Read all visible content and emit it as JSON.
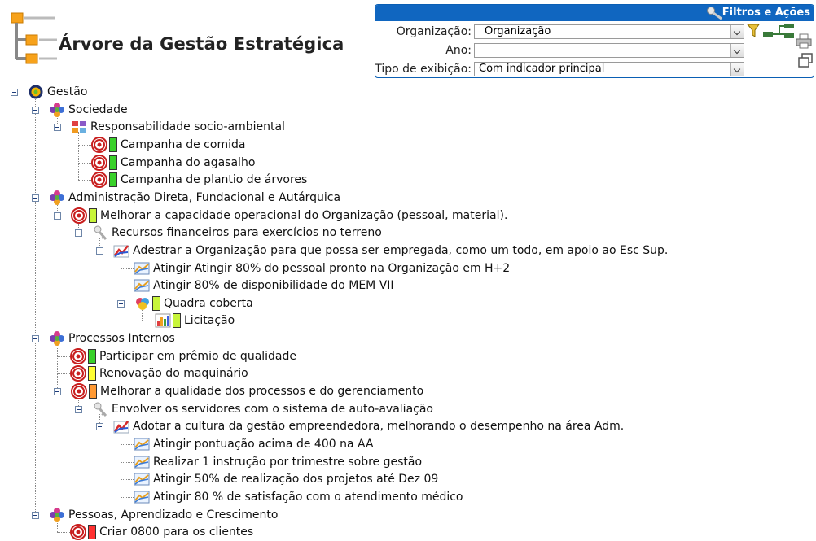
{
  "header": {
    "title": "Árvore da Gestão Estratégica"
  },
  "filters": {
    "title": "Filtros e Ações",
    "fields": [
      {
        "label": "Organização:",
        "value": "Organização"
      },
      {
        "label": "Ano:",
        "value": ""
      },
      {
        "label": "Tipo de exibição:",
        "value": "Com indicador principal"
      }
    ]
  },
  "colors": {
    "panel_header": "#1066c0",
    "status_green": "#39d12a",
    "status_lime": "#c8f53a",
    "status_yellow": "#ffff33",
    "status_orange": "#ff9933",
    "status_red": "#ff3030"
  },
  "tree": [
    {
      "label": "Gestão",
      "icon": "gestao-icon",
      "depth": 0
    },
    {
      "label": "Sociedade",
      "icon": "perspective-icon",
      "depth": 1
    },
    {
      "label": "Responsabilidade socio-ambiental",
      "icon": "theme-icon",
      "depth": 2
    },
    {
      "label": "Campanha de comida",
      "icon": "target-icon",
      "depth": 3,
      "status": "green"
    },
    {
      "label": "Campanha do agasalho",
      "icon": "target-icon",
      "depth": 3,
      "status": "green"
    },
    {
      "label": "Campanha de plantio de árvores",
      "icon": "target-icon",
      "depth": 3,
      "status": "green"
    },
    {
      "label": "Administração Direta, Fundacional e Autárquica",
      "icon": "perspective-icon",
      "depth": 1
    },
    {
      "label": "Melhorar a capacidade operacional do Organização (pessoal, material).",
      "icon": "target-icon",
      "depth": 2,
      "status": "lime"
    },
    {
      "label": "Recursos financeiros para exercícios no terreno",
      "icon": "key-icon",
      "depth": 3
    },
    {
      "label": "Adestrar a Organização para que possa ser empregada, como um todo, em apoio ao Esc Sup.",
      "icon": "trend-chart-icon",
      "depth": 4
    },
    {
      "label": "Atingir Atingir 80% do pessoal pronto na Organização em H+2",
      "icon": "indicator-icon",
      "depth": 5
    },
    {
      "label": "Atingir 80% de disponibilidade do MEM VII",
      "icon": "indicator-icon",
      "depth": 5
    },
    {
      "label": "Quadra coberta",
      "icon": "project-icon",
      "depth": 5,
      "status": "lime"
    },
    {
      "label": "Licitação",
      "icon": "bar-chart-icon",
      "depth": 6,
      "status": "lime"
    },
    {
      "label": "Processos Internos",
      "icon": "perspective-icon",
      "depth": 1
    },
    {
      "label": "Participar em prêmio de qualidade",
      "icon": "target-icon",
      "depth": 2,
      "status": "green"
    },
    {
      "label": "Renovação do maquinário",
      "icon": "target-icon",
      "depth": 2,
      "status": "yellow"
    },
    {
      "label": "Melhorar a qualidade dos processos e do gerenciamento",
      "icon": "target-icon",
      "depth": 2,
      "status": "orange"
    },
    {
      "label": "Envolver os servidores com o sistema de auto-avaliação",
      "icon": "key-icon",
      "depth": 3
    },
    {
      "label": "Adotar a cultura da gestão empreendedora, melhorando o desempenho na área Adm.",
      "icon": "trend-chart-icon",
      "depth": 4
    },
    {
      "label": "Atingir pontuação acima de 400 na AA",
      "icon": "indicator-icon",
      "depth": 5
    },
    {
      "label": "Realizar 1 instrução por trimestre sobre gestão",
      "icon": "indicator-icon",
      "depth": 5
    },
    {
      "label": "Atingir 50% de realização dos projetos até Dez 09",
      "icon": "indicator-icon",
      "depth": 5
    },
    {
      "label": "Atingir 80 % de satisfação com o atendimento médico",
      "icon": "indicator-icon",
      "depth": 5
    },
    {
      "label": "Pessoas, Aprendizado e Crescimento",
      "icon": "perspective-icon",
      "depth": 1
    },
    {
      "label": "Criar 0800 para os clientes",
      "icon": "target-icon",
      "depth": 2,
      "status": "red"
    }
  ]
}
